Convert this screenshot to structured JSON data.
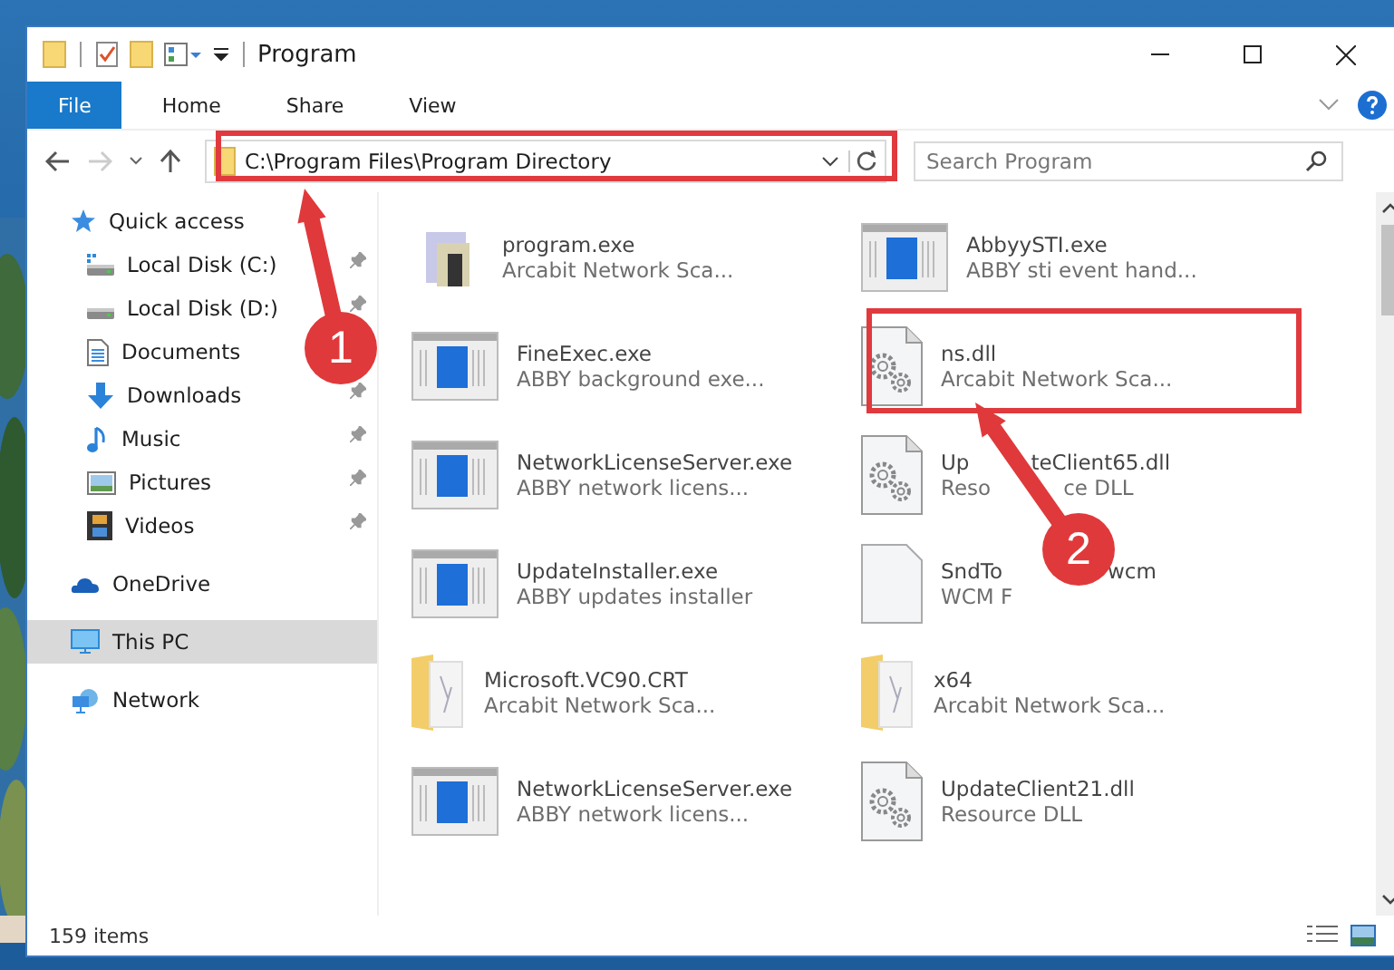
{
  "window": {
    "title": "Program"
  },
  "ribbon_tabs": [
    {
      "label": "File",
      "selected": true
    },
    {
      "label": "Home",
      "selected": false
    },
    {
      "label": "Share",
      "selected": false
    },
    {
      "label": "View",
      "selected": false
    }
  ],
  "address_bar": {
    "path": "C:\\Program Files\\Program Directory"
  },
  "search": {
    "placeholder": "Search Program"
  },
  "sidebar": {
    "items": [
      {
        "label": "Quick access",
        "selected": false,
        "children": [
          {
            "label": "Local Disk (C:)",
            "pinned": true
          },
          {
            "label": "Local Disk (D:)",
            "pinned": true
          },
          {
            "label": "Documents"
          },
          {
            "label": "Downloads",
            "pinned": true
          },
          {
            "label": "Music",
            "pinned": true
          },
          {
            "label": "Pictures",
            "pinned": true
          },
          {
            "label": "Videos",
            "pinned": true
          }
        ]
      },
      {
        "label": "OneDrive",
        "selected": false
      },
      {
        "label": "This PC",
        "selected": true
      },
      {
        "label": "Network",
        "selected": false
      }
    ]
  },
  "files": [
    {
      "name": "program.exe",
      "description": "Arcabit Network Sca...",
      "kind": "installer"
    },
    {
      "name": "AbbyySTI.exe",
      "description": "ABBY sti event hand...",
      "kind": "app"
    },
    {
      "name": "FineExec.exe",
      "description": "ABBY background exe...",
      "kind": "app"
    },
    {
      "name": "ns.dll",
      "description": "Arcabit Network Sca...",
      "kind": "dll"
    },
    {
      "name": "NetworkLicenseServer.exe",
      "description": "ABBY network licens...",
      "kind": "app"
    },
    {
      "name_parts": [
        "Up",
        "teClient65.dll"
      ],
      "description_parts": [
        "Reso",
        "ce DLL"
      ],
      "kind": "dll"
    },
    {
      "name": "UpdateInstaller.exe",
      "description": "ABBY updates installer",
      "kind": "app"
    },
    {
      "name_parts": [
        "SndTo",
        "wcm"
      ],
      "description": "WCM F",
      "kind": "blank"
    },
    {
      "name": "Microsoft.VC90.CRT",
      "description": "Arcabit Network Sca...",
      "kind": "folder"
    },
    {
      "name": "x64",
      "description": "Arcabit Network Sca...",
      "kind": "folder"
    },
    {
      "name": "NetworkLicenseServer.exe",
      "description": "ABBY network licens...",
      "kind": "app"
    },
    {
      "name": "UpdateClient21.dll",
      "description": "Resource DLL",
      "kind": "dll"
    }
  ],
  "status_bar": {
    "count": "159 items"
  },
  "annotations": [
    {
      "kind": "box"
    },
    {
      "kind": "box"
    },
    {
      "kind": "callout",
      "number": "1"
    },
    {
      "kind": "callout",
      "number": "2"
    }
  ]
}
